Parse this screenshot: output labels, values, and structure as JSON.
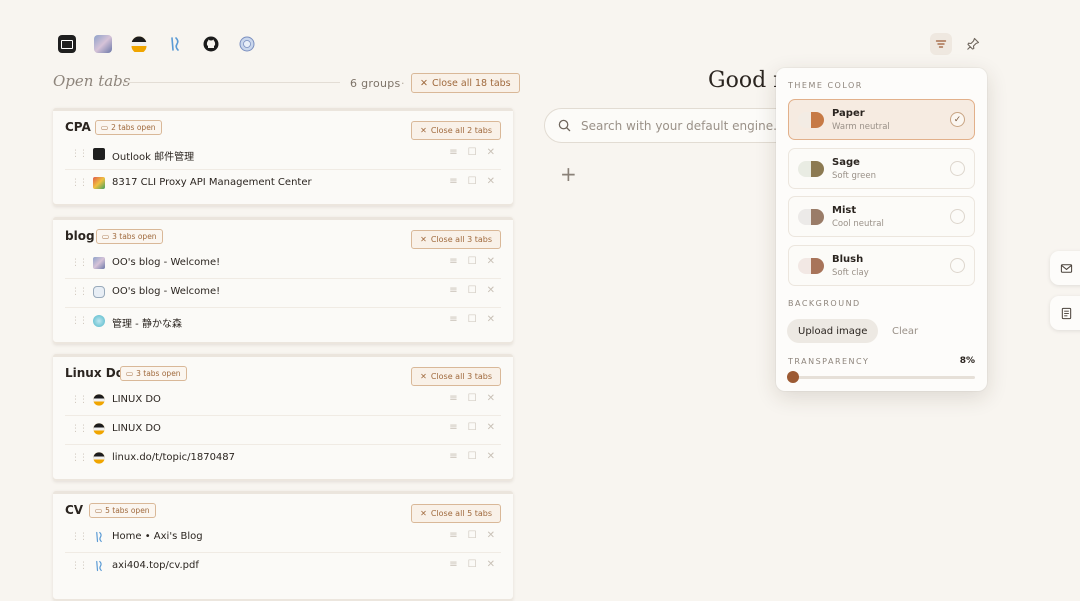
{
  "open_tabs": {
    "title": "Open tabs",
    "groups_count": "6 groups",
    "separator": "·",
    "close_all_label": "Close all 18 tabs"
  },
  "groups": [
    {
      "name": "CPA",
      "badge": "2 tabs open",
      "close_label": "Close all 2 tabs",
      "tabs": [
        {
          "title": "Outlook 邮件管理"
        },
        {
          "title": "8317 CLI Proxy API Management Center"
        }
      ]
    },
    {
      "name": "blog",
      "badge": "3 tabs open",
      "close_label": "Close all 3 tabs",
      "tabs": [
        {
          "title": "OO's blog - Welcome!"
        },
        {
          "title": "OO's blog - Welcome!"
        },
        {
          "title": "管理 - 静かな森"
        }
      ]
    },
    {
      "name": "Linux Do",
      "badge": "3 tabs open",
      "close_label": "Close all 3 tabs",
      "tabs": [
        {
          "title": "LINUX DO"
        },
        {
          "title": "LINUX DO"
        },
        {
          "title": "linux.do/t/topic/1870487"
        }
      ]
    },
    {
      "name": "CV",
      "badge": "5 tabs open",
      "close_label": "Close all 5 tabs",
      "tabs": [
        {
          "title": "Home • Axi's Blog"
        },
        {
          "title": "axi404.top/cv.pdf"
        }
      ]
    }
  ],
  "greeting": "Good n",
  "search": {
    "placeholder": "Search with your default engine..."
  },
  "plus_label": "+",
  "theme_panel": {
    "theme_color_label": "THEME COLOR",
    "themes": [
      {
        "name": "Paper",
        "desc": "Warm neutral",
        "selected": true,
        "colors": [
          "#f3ece4",
          "#c77a45"
        ]
      },
      {
        "name": "Sage",
        "desc": "Soft green",
        "selected": false,
        "colors": [
          "#e9ece3",
          "#8c7a52"
        ]
      },
      {
        "name": "Mist",
        "desc": "Cool neutral",
        "selected": false,
        "colors": [
          "#eceae8",
          "#9a7c68"
        ]
      },
      {
        "name": "Blush",
        "desc": "Soft clay",
        "selected": false,
        "colors": [
          "#f2e8e4",
          "#a8745a"
        ]
      }
    ],
    "background_label": "BACKGROUND",
    "upload_label": "Upload image",
    "clear_label": "Clear",
    "transparency_label": "TRANSPARENCY",
    "transparency_value": "8%",
    "transparency_fraction": 0.0
  },
  "colors": {
    "accent": "#a06a3d",
    "slider": "#9c5a33",
    "background": "#f8f5f0"
  },
  "icons": {
    "top_bar": [
      "outlook-icon",
      "blog-avatar-icon",
      "linuxdo-icon",
      "axi-icon",
      "github-icon",
      "globe-icon"
    ],
    "header_right": [
      "filter-icon",
      "pin-icon"
    ],
    "edge": [
      "mail-icon",
      "notes-icon"
    ]
  }
}
